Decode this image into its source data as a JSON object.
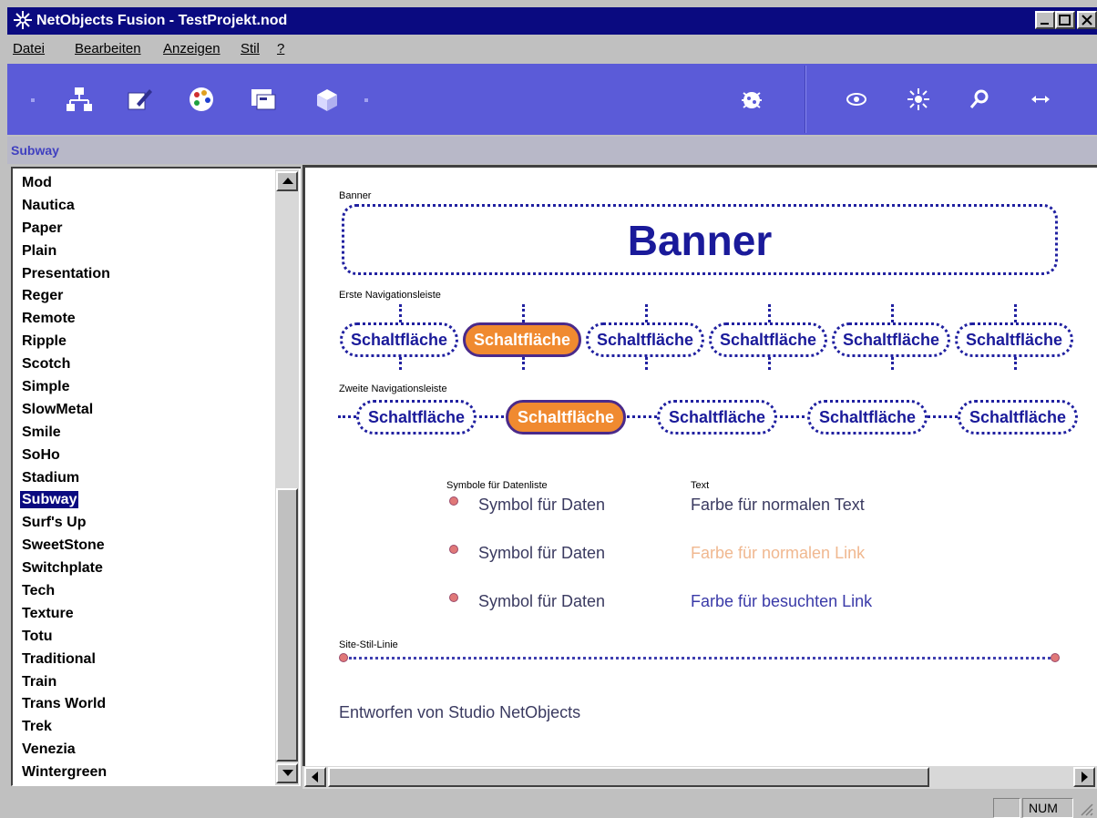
{
  "window": {
    "title": "NetObjects Fusion - TestProjekt.nod"
  },
  "menu": [
    "Datei",
    "Bearbeiten",
    "Anzeigen",
    "Stil",
    "?"
  ],
  "toolbar": {
    "left_icons": [
      "site-view-icon",
      "page-view-icon",
      "style-view-icon",
      "assets-view-icon",
      "publish-view-icon"
    ],
    "center_icons": [
      "bug-icon"
    ],
    "right_icons": [
      "preview-eye-icon",
      "sun-icon",
      "search-icon",
      "arrows-icon"
    ]
  },
  "subbar": {
    "label": "Subway"
  },
  "style_list": {
    "items": [
      "Mod",
      "Nautica",
      "Paper",
      "Plain",
      "Presentation",
      "Reger",
      "Remote",
      "Ripple",
      "Scotch",
      "Simple",
      "SlowMetal",
      "Smile",
      "SoHo",
      "Stadium",
      "Subway",
      "Surf's Up",
      "SweetStone",
      "Switchplate",
      "Tech",
      "Texture",
      "Totu",
      "Traditional",
      "Train",
      "Trans World",
      "Trek",
      "Venezia",
      "Wintergreen"
    ],
    "selected": "Subway"
  },
  "preview": {
    "banner_label": "Banner",
    "banner_text": "Banner",
    "nav1_label": "Erste Navigationsleiste",
    "nav1_buttons": [
      "Schaltfläche",
      "Schaltfläche",
      "Schaltfläche",
      "Schaltfläche",
      "Schaltfläche",
      "Schaltfläche"
    ],
    "nav2_label": "Zweite Navigationsleiste",
    "nav2_buttons": [
      "Schaltfläche",
      "Schaltfläche",
      "Schaltfläche",
      "Schaltfläche",
      "Schaltfläche"
    ],
    "datalist_label": "Symbole für Datenliste",
    "datalist_items": [
      "Symbol für Daten",
      "Symbol für Daten",
      "Symbol für Daten"
    ],
    "text_label": "Text",
    "text_items": [
      "Farbe für normalen Text",
      "Farbe für normalen Link",
      "Farbe für besuchten Link"
    ],
    "text_colors": [
      "#3a3a60",
      "#f0b890",
      "#3a3aa8"
    ],
    "line_label": "Site-Stil-Linie",
    "credit": "Entworfen von Studio NetObjects"
  },
  "status": {
    "num": "NUM"
  },
  "colors": {
    "accent": "#5b5bd8",
    "title_bar": "#0a0a80",
    "nav_active": "#f08a30",
    "nav_text": "#1a1a9a"
  }
}
